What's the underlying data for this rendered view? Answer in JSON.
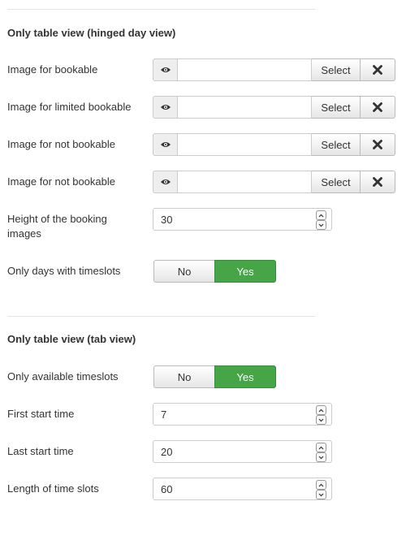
{
  "section1": {
    "title": "Only table view (hinged day view)",
    "image_rows": [
      {
        "label": "Image for bookable",
        "value": "",
        "select_label": "Select"
      },
      {
        "label": "Image for limited bookable",
        "value": "",
        "select_label": "Select"
      },
      {
        "label": "Image for not bookable",
        "value": "",
        "select_label": "Select"
      },
      {
        "label": "Image for not bookable",
        "value": "",
        "select_label": "Select"
      }
    ],
    "height": {
      "label": "Height of the booking images",
      "value": "30"
    },
    "only_days": {
      "label": "Only days with timeslots",
      "no_label": "No",
      "yes_label": "Yes",
      "selected": "Yes"
    }
  },
  "section2": {
    "title": "Only table view (tab view)",
    "only_available": {
      "label": "Only available timeslots",
      "no_label": "No",
      "yes_label": "Yes",
      "selected": "Yes"
    },
    "first_start": {
      "label": "First start time",
      "value": "7"
    },
    "last_start": {
      "label": "Last start time",
      "value": "20"
    },
    "slot_length": {
      "label": "Length of time slots",
      "value": "60"
    }
  },
  "colors": {
    "toggle_active": "#46a546",
    "border": "#cccccc",
    "text": "#333333"
  },
  "icons": {
    "preview": "eye-icon",
    "clear": "close-icon",
    "spin_up": "chevron-up-icon",
    "spin_down": "chevron-down-icon"
  }
}
